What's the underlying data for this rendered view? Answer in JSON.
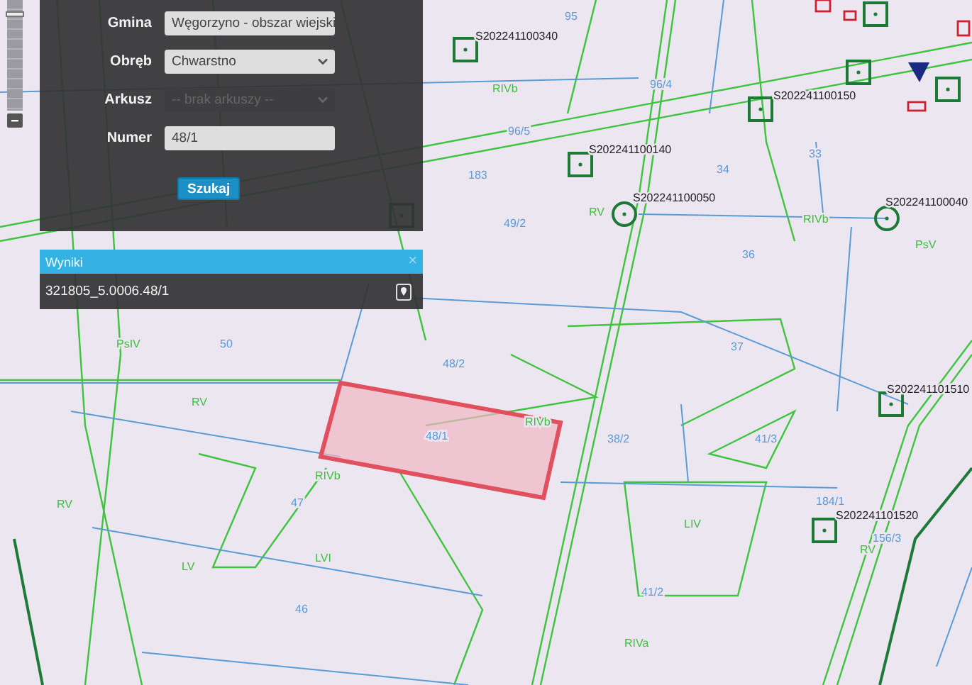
{
  "zoom_slider": {
    "level": 0.88
  },
  "search_panel": {
    "fields": [
      {
        "label": "Gmina",
        "kind": "select",
        "value": "Węgorzyno - obszar wiejski",
        "disabled": false
      },
      {
        "label": "Obręb",
        "kind": "select",
        "value": "Chwarstno",
        "disabled": false
      },
      {
        "label": "Arkusz",
        "kind": "select",
        "value": "-- brak arkuszy --",
        "disabled": true
      },
      {
        "label": "Numer",
        "kind": "text",
        "value": "48/1",
        "disabled": false
      }
    ],
    "button": "Szukaj"
  },
  "results": {
    "title": "Wyniki",
    "close": "×",
    "items": [
      "321805_5.0006.48/1"
    ]
  },
  "map_labels": [
    {
      "text": "S202241100340",
      "kind": "point"
    },
    {
      "text": "S202241100150",
      "kind": "point"
    },
    {
      "text": "S202241100140",
      "kind": "point"
    },
    {
      "text": "S202241100050",
      "kind": "point"
    },
    {
      "text": "S202241100040",
      "kind": "point"
    },
    {
      "text": "S202241101510",
      "kind": "point"
    },
    {
      "text": "S202241101520",
      "kind": "point"
    },
    {
      "text": "95",
      "kind": "parcel"
    },
    {
      "text": "96/4",
      "kind": "parcel"
    },
    {
      "text": "96/5",
      "kind": "parcel"
    },
    {
      "text": "183",
      "kind": "parcel"
    },
    {
      "text": "49/2",
      "kind": "parcel"
    },
    {
      "text": "34",
      "kind": "parcel"
    },
    {
      "text": "33",
      "kind": "parcel"
    },
    {
      "text": "36",
      "kind": "parcel"
    },
    {
      "text": "50",
      "kind": "parcel"
    },
    {
      "text": "37",
      "kind": "parcel"
    },
    {
      "text": "48/2",
      "kind": "parcel"
    },
    {
      "text": "48/1",
      "kind": "parcel"
    },
    {
      "text": "38/2",
      "kind": "parcel"
    },
    {
      "text": "41/3",
      "kind": "parcel"
    },
    {
      "text": "47",
      "kind": "parcel"
    },
    {
      "text": "46",
      "kind": "parcel"
    },
    {
      "text": "41/2",
      "kind": "parcel"
    },
    {
      "text": "184/1",
      "kind": "parcel"
    },
    {
      "text": "156/3",
      "kind": "parcel"
    },
    {
      "text": "RV",
      "kind": "class"
    },
    {
      "text": "RIVb",
      "kind": "class"
    },
    {
      "text": "RV",
      "kind": "class"
    },
    {
      "text": "RIVb",
      "kind": "class"
    },
    {
      "text": "PsV",
      "kind": "class"
    },
    {
      "text": "PsIV",
      "kind": "class"
    },
    {
      "text": "RV",
      "kind": "class"
    },
    {
      "text": "RIVb",
      "kind": "class"
    },
    {
      "text": "RIVa",
      "kind": "class"
    },
    {
      "text": "LIV",
      "kind": "class"
    },
    {
      "text": "RV",
      "kind": "class"
    },
    {
      "text": "LV",
      "kind": "class"
    },
    {
      "text": "LVI",
      "kind": "class"
    },
    {
      "text": "RIVb",
      "kind": "class"
    }
  ]
}
